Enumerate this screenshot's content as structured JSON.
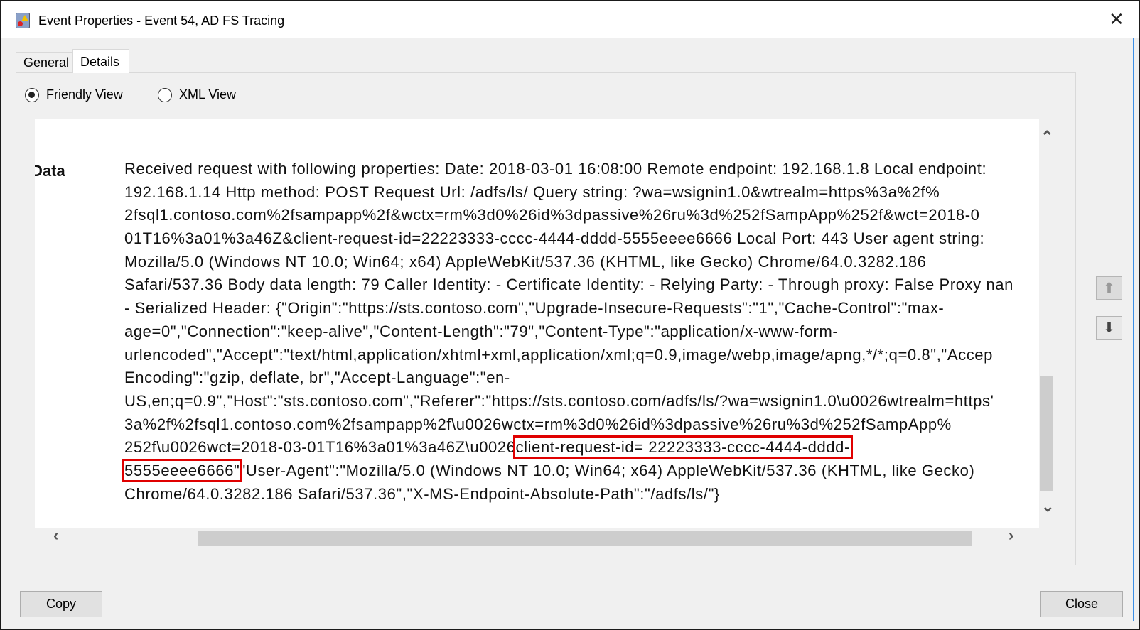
{
  "window": {
    "title": "Event Properties - Event 54, AD FS Tracing",
    "close_glyph": "✕"
  },
  "tabs": [
    {
      "label": "General",
      "active": false
    },
    {
      "label": "Details",
      "active": true
    }
  ],
  "view_options": [
    {
      "label": "Friendly View",
      "selected": true
    },
    {
      "label": "XML View",
      "selected": false
    }
  ],
  "details": {
    "field_label": "Data",
    "lines": [
      {
        "pre": "Received request with following properties: Date: 2018-03-01 16:08:00 Remote endpoint: 192.168.1.8 Local endpoint:"
      },
      {
        "pre": "192.168.1.14 Http method: POST Request Url: /adfs/ls/ Query string: ?wa=wsignin1.0&wtrealm=https%3a%2f%"
      },
      {
        "pre": "2fsql1.contoso.com%2fsampapp%2f&wctx=rm%3d0%26id%3dpassive%26ru%3d%252fSampApp%252f&wct=2018-0"
      },
      {
        "pre": "01T16%3a01%3a46Z&client-request-id=22223333-cccc-4444-dddd-5555eeee6666 Local Port: 443 User agent string:"
      },
      {
        "pre": "Mozilla/5.0 (Windows NT 10.0; Win64; x64) AppleWebKit/537.36 (KHTML, like Gecko) Chrome/64.0.3282.186"
      },
      {
        "pre": "Safari/537.36 Body data length: 79 Caller Identity: - Certificate Identity: - Relying Party: - Through proxy: False Proxy nan"
      },
      {
        "pre": "- Serialized Header: {\"Origin\":\"https://sts.contoso.com\",\"Upgrade-Insecure-Requests\":\"1\",\"Cache-Control\":\"max-"
      },
      {
        "pre": "age=0\",\"Connection\":\"keep-alive\",\"Content-Length\":\"79\",\"Content-Type\":\"application/x-www-form-"
      },
      {
        "pre": "urlencoded\",\"Accept\":\"text/html,application/xhtml+xml,application/xml;q=0.9,image/webp,image/apng,*/*;q=0.8\",\"Accep"
      },
      {
        "pre": "Encoding\":\"gzip, deflate, br\",\"Accept-Language\":\"en-"
      },
      {
        "pre": "US,en;q=0.9\",\"Host\":\"sts.contoso.com\",\"Referer\":\"https://sts.contoso.com/adfs/ls/?wa=wsignin1.0\\u0026wtrealm=https'"
      },
      {
        "pre": "3a%2f%2fsql1.contoso.com%2fsampapp%2f\\u0026wctx=rm%3d0%26id%3dpassive%26ru%3d%252fSampApp%"
      },
      {
        "pre": "252f\\u0026wct=2018-03-01T16%3a01%3a46Z\\u0026",
        "hl": "client-request-id= 22223333-cccc-4444-dddd-",
        "post": ""
      },
      {
        "pre": "",
        "hl": "5555eeee6666\"",
        "post": "\"User-Agent\":\"Mozilla/5.0 (Windows NT 10.0; Win64; x64) AppleWebKit/537.36 (KHTML, like Gecko)"
      },
      {
        "pre": "Chrome/64.0.3282.186 Safari/537.36\",\"X-MS-Endpoint-Absolute-Path\":\"/adfs/ls/\"}"
      }
    ],
    "highlight_color": "#e00000"
  },
  "buttons": {
    "copy": "Copy",
    "close": "Close"
  }
}
